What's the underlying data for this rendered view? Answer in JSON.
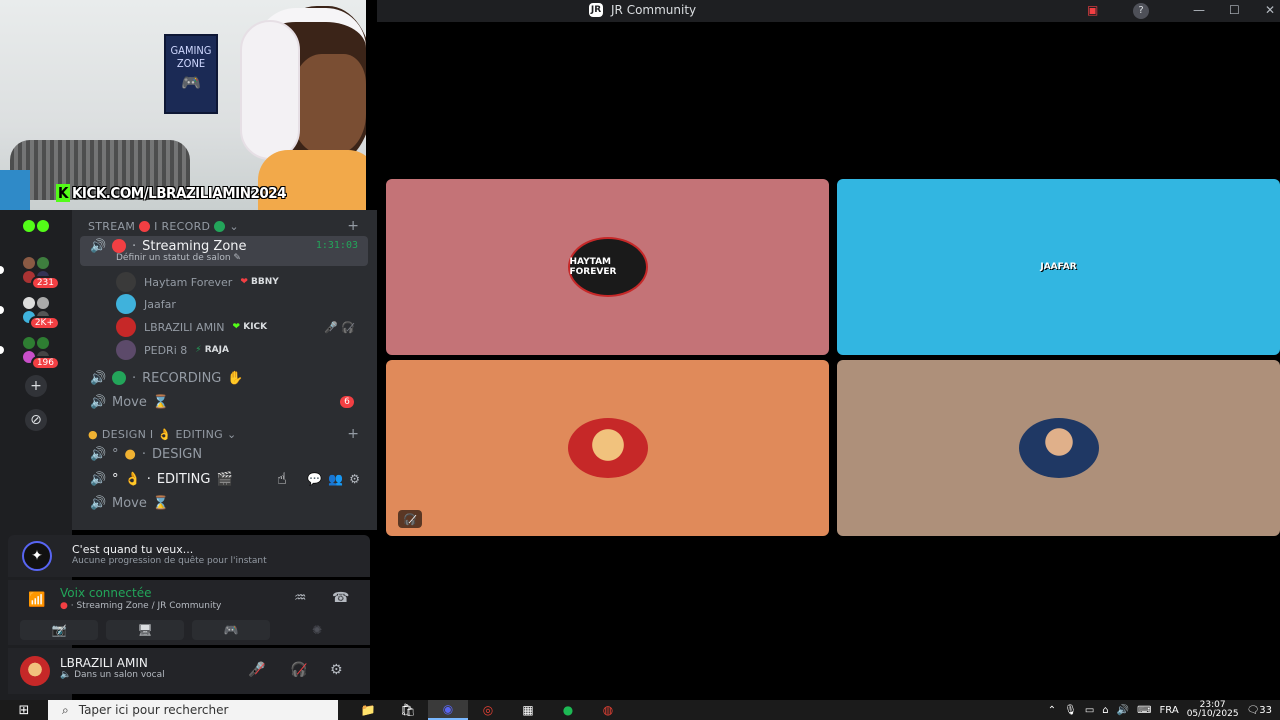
{
  "window": {
    "title": "JR Community",
    "logo": "JR",
    "buttons": {
      "minimize": "—",
      "maximize": "☐",
      "close": "✕",
      "help": "?",
      "inbox": "▣"
    }
  },
  "webcam": {
    "poster_line1": "GAMING",
    "poster_line2": "ZONE",
    "kick_badge": "K",
    "kick_url": "KICK.COM/LBRAZILIAMIN2024"
  },
  "rail": {
    "badge_1": "231",
    "badge_2": "2K+",
    "badge_3": "196",
    "add_icon": "+",
    "discover_icon": "⊘"
  },
  "categories": {
    "stream": {
      "label": "STREAM",
      "label2": "I RECORD",
      "chevron": "⌄",
      "plus": "+"
    },
    "design": {
      "label": "DESIGN I",
      "label2": "EDITING",
      "chevron": "⌄",
      "plus": "+"
    }
  },
  "channels": {
    "streaming_zone": {
      "name": "Streaming Zone",
      "status": "Définir un statut de salon",
      "timer": "1:31:03",
      "dot_color": "#f23f43"
    },
    "recording": {
      "name": "RECORDING",
      "dot_color": "#23a55a"
    },
    "move1": {
      "name": "Move",
      "suffix": "⌛",
      "count": "6"
    },
    "design": {
      "name": "DESIGN",
      "prefix": "°"
    },
    "editing": {
      "name": "EDITING",
      "prefix": "°"
    },
    "move2": {
      "name": "Move",
      "suffix": "⌛"
    }
  },
  "members": [
    {
      "name": "Haytam Forever",
      "tag": "BBNY",
      "avatar_color": "#3a3a3a"
    },
    {
      "name": "Jaafar",
      "tag": "",
      "avatar_color": "#3fb2dc"
    },
    {
      "name": "LBRAZILI AMIN",
      "tag": "KICK",
      "avatar_color": "#c62828"
    },
    {
      "name": "PEDRi 8",
      "tag": "RAJA",
      "avatar_color": "#5c4a6a"
    }
  ],
  "quest": {
    "title": "C'est quand tu veux...",
    "subtitle": "Aucune progression de quête pour l'instant"
  },
  "voice": {
    "title": "Voix connectée",
    "location": "Streaming Zone / JR Community"
  },
  "user": {
    "name": "LBRAZILI AMIN",
    "status": "Dans un salon vocal"
  },
  "tiles": [
    {
      "label": "HAYTAM FOREVER",
      "bg": "#c47377",
      "avatar_bg": "#1a1a1a"
    },
    {
      "label": "JAAFAR",
      "bg": "#32b6e1",
      "avatar_bg": "#32b6e1"
    },
    {
      "label": "",
      "bg": "#e08a5a",
      "avatar_bg": "#c62828"
    },
    {
      "label": "",
      "bg": "#ae907a",
      "avatar_bg": "#1f3864"
    }
  ],
  "taskbar": {
    "search_placeholder": "Taper ici pour rechercher",
    "lang": "FRA",
    "time": "23:07",
    "date": "05/10/2025",
    "notif_count": "33"
  }
}
